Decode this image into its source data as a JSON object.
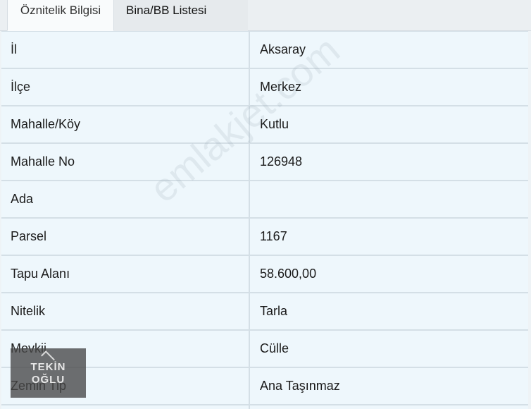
{
  "tabs": [
    {
      "label": "Öznitelik Bilgisi",
      "active": true
    },
    {
      "label": "Bina/BB Listesi",
      "active": false
    }
  ],
  "rows": [
    {
      "label": "İl",
      "value": "Aksaray"
    },
    {
      "label": "İlçe",
      "value": "Merkez"
    },
    {
      "label": "Mahalle/Köy",
      "value": "Kutlu"
    },
    {
      "label": "Mahalle No",
      "value": "126948"
    },
    {
      "label": "Ada",
      "value": ""
    },
    {
      "label": "Parsel",
      "value": "1167"
    },
    {
      "label": "Tapu Alanı",
      "value": "58.600,00"
    },
    {
      "label": "Nitelik",
      "value": "Tarla"
    },
    {
      "label": "Mevkii",
      "value": "Cülle"
    },
    {
      "label": "Zemin Tip",
      "value": "Ana Taşınmaz"
    }
  ],
  "watermark": "emlakjet.com",
  "logo": {
    "line1": "TEKİN",
    "line2": "OĞLU"
  }
}
